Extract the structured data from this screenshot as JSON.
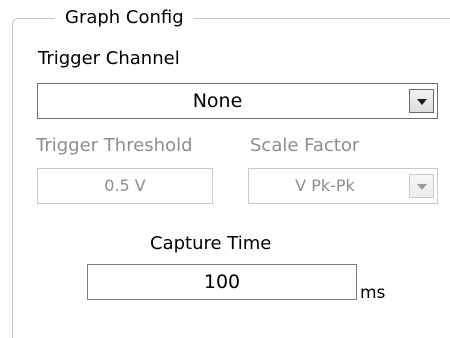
{
  "group": {
    "title": "Graph Config"
  },
  "trigger_channel": {
    "label": "Trigger Channel",
    "selected": "None",
    "enabled": true
  },
  "trigger_threshold": {
    "label": "Trigger Threshold",
    "value": "0.5 V",
    "enabled": false
  },
  "scale_factor": {
    "label": "Scale Factor",
    "selected": "V Pk-Pk",
    "enabled": false
  },
  "capture_time": {
    "label": "Capture Time",
    "value": "100",
    "unit": "ms",
    "enabled": true
  },
  "icons": {
    "dropdown": "chevron-down-icon"
  },
  "colors": {
    "text": "#000000",
    "disabled_text": "#8e8e8e",
    "group_border": "#c4c4c4",
    "enabled_border": "#707070",
    "disabled_border": "#c9c9c9"
  }
}
